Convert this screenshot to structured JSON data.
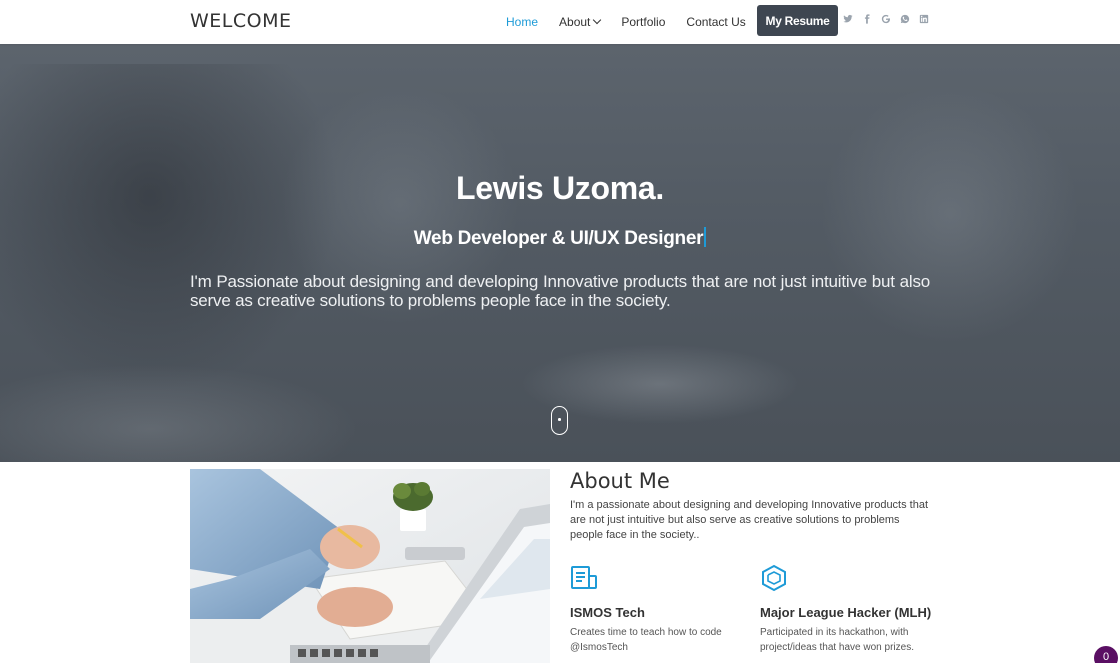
{
  "brand": "WELCOME",
  "nav": {
    "items": [
      {
        "label": "Home",
        "active": true
      },
      {
        "label": "About",
        "dropdown": true
      },
      {
        "label": "Portfolio"
      },
      {
        "label": "Contact Us"
      }
    ],
    "resume_label": "My Resume",
    "socials": [
      "twitter-icon",
      "facebook-icon",
      "google-plus-icon",
      "whatsapp-icon",
      "linkedin-icon"
    ]
  },
  "hero": {
    "name": "Lewis Uzoma.",
    "role": "Web Developer & UI/UX Designer",
    "description": "I'm Passionate about designing and developing Innovative products that are not just intuitive but also serve as creative solutions to problems people face in the society."
  },
  "about": {
    "title": "About Me",
    "text": "I'm a passionate about designing and developing Innovative products that are not just intuitive but also serve as creative solutions to problems people face in the society..",
    "features": [
      {
        "title": "ISMOS Tech",
        "description": "Creates time to teach how to code @IsmosTech",
        "icon": "document-icon"
      },
      {
        "title": "Major League Hacker (MLH)",
        "description": "Participated in its hackathon, with project/ideas that have won prizes.",
        "icon": "hexagon-cube-icon"
      }
    ]
  },
  "badge": "0",
  "colors": {
    "accent": "#1e9bd7",
    "button": "#3e4651",
    "badge": "#5a0f63"
  }
}
